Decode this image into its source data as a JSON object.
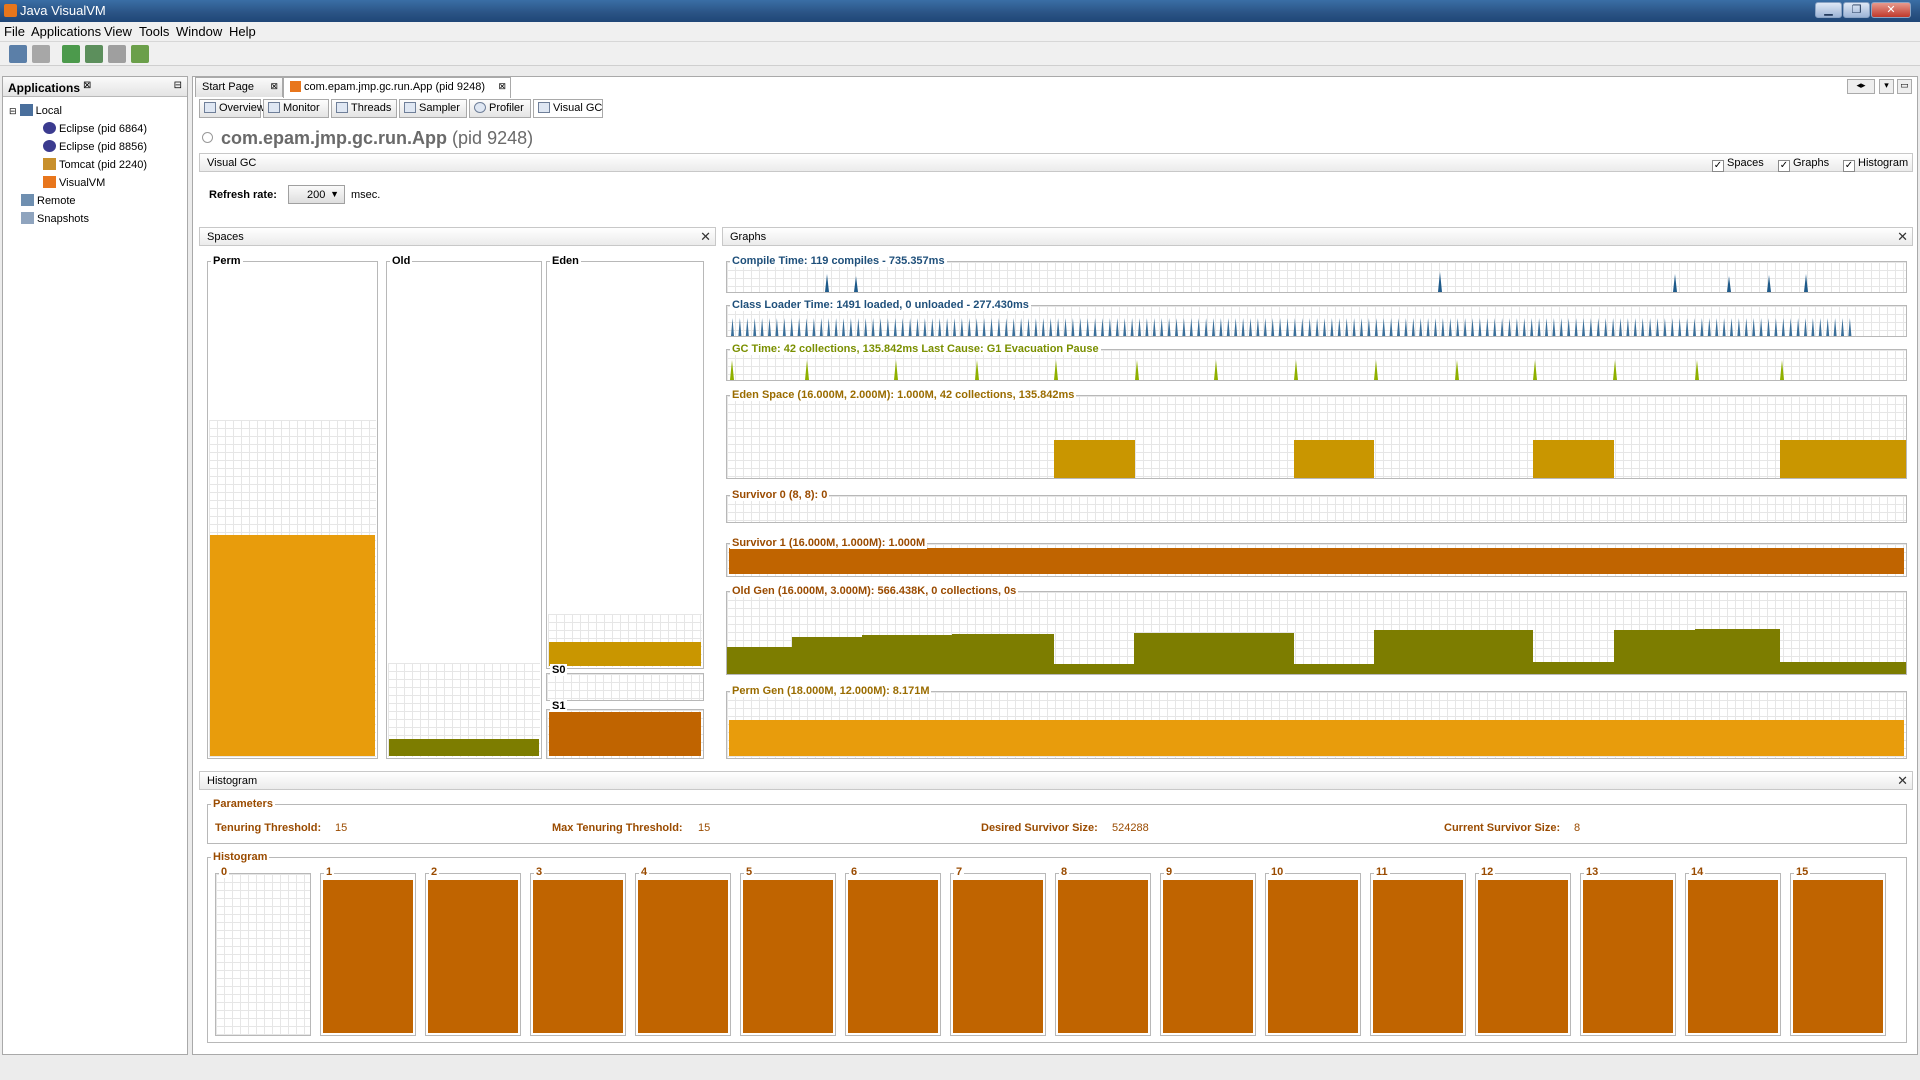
{
  "window": {
    "title": "Java VisualVM"
  },
  "menu": [
    "File",
    "Applications",
    "View",
    "Tools",
    "Window",
    "Help"
  ],
  "left_panel": {
    "title": "Applications",
    "tree": [
      {
        "label": "Local"
      },
      {
        "label": "Eclipse (pid 6864)"
      },
      {
        "label": "Eclipse (pid 8856)"
      },
      {
        "label": "Tomcat (pid 2240)"
      },
      {
        "label": "VisualVM"
      },
      {
        "label": "Remote"
      },
      {
        "label": "Snapshots"
      }
    ]
  },
  "doc_tabs": [
    "Start Page",
    "com.epam.jmp.gc.run.App (pid 9248)"
  ],
  "sub_tabs": [
    "Overview",
    "Monitor",
    "Threads",
    "Sampler",
    "Profiler",
    "Visual GC"
  ],
  "app": {
    "name": "com.epam.jmp.gc.run.App",
    "pid": "(pid 9248)"
  },
  "visual_gc": {
    "title": "Visual GC",
    "options": [
      "Spaces",
      "Graphs",
      "Histogram"
    ],
    "refresh_label": "Refresh rate:",
    "refresh_value": "200",
    "refresh_unit": "msec."
  },
  "spaces": {
    "title": "Spaces",
    "perm": {
      "label": "Perm",
      "capacity_frac": 0.68,
      "used_frac": 0.45
    },
    "old": {
      "label": "Old",
      "capacity_frac": 0.19,
      "used_frac": 0.035
    },
    "eden": {
      "label": "Eden",
      "capacity_frac": 0.13,
      "used_frac": 0.06
    },
    "s0": {
      "label": "S0",
      "used_frac": 0.0
    },
    "s1": {
      "label": "S1",
      "used_frac": 1.0
    }
  },
  "graphs": {
    "title": "Graphs",
    "compile": "Compile Time: 119 compiles - 735.357ms",
    "classloader": "Class Loader Time: 1491 loaded, 0 unloaded - 277.430ms",
    "gc": "GC Time: 42 collections, 135.842ms Last Cause: G1 Evacuation Pause",
    "eden": "Eden Space (16.000M, 2.000M): 1.000M, 42 collections, 135.842ms",
    "survivor0": "Survivor 0 (8, 8): 0",
    "survivor1": "Survivor 1 (16.000M, 1.000M): 1.000M",
    "oldgen": "Old Gen (16.000M, 3.000M): 566.438K, 0 collections, 0s",
    "permgen": "Perm Gen (18.000M, 12.000M): 8.171M"
  },
  "histogram": {
    "title": "Histogram",
    "parameters_title": "Parameters",
    "params": [
      {
        "label": "Tenuring Threshold:",
        "value": "15"
      },
      {
        "label": "Max Tenuring Threshold:",
        "value": "15"
      },
      {
        "label": "Desired Survivor Size:",
        "value": "524288"
      },
      {
        "label": "Current Survivor Size:",
        "value": "8"
      }
    ],
    "histogram_title": "Histogram",
    "bins": [
      {
        "label": "0",
        "fill": 0.0
      },
      {
        "label": "1",
        "fill": 1.0
      },
      {
        "label": "2",
        "fill": 1.0
      },
      {
        "label": "3",
        "fill": 1.0
      },
      {
        "label": "4",
        "fill": 1.0
      },
      {
        "label": "5",
        "fill": 1.0
      },
      {
        "label": "6",
        "fill": 1.0
      },
      {
        "label": "7",
        "fill": 1.0
      },
      {
        "label": "8",
        "fill": 1.0
      },
      {
        "label": "9",
        "fill": 1.0
      },
      {
        "label": "10",
        "fill": 1.0
      },
      {
        "label": "11",
        "fill": 1.0
      },
      {
        "label": "12",
        "fill": 1.0
      },
      {
        "label": "13",
        "fill": 1.0
      },
      {
        "label": "14",
        "fill": 1.0
      },
      {
        "label": "15",
        "fill": 1.0
      }
    ]
  },
  "colors": {
    "perm": "#e89c0c",
    "old": "#7d7d00",
    "eden": "#c99600",
    "survivor": "#c06400",
    "compile": "#1e5a8a",
    "label_title": "#9a4b00"
  }
}
